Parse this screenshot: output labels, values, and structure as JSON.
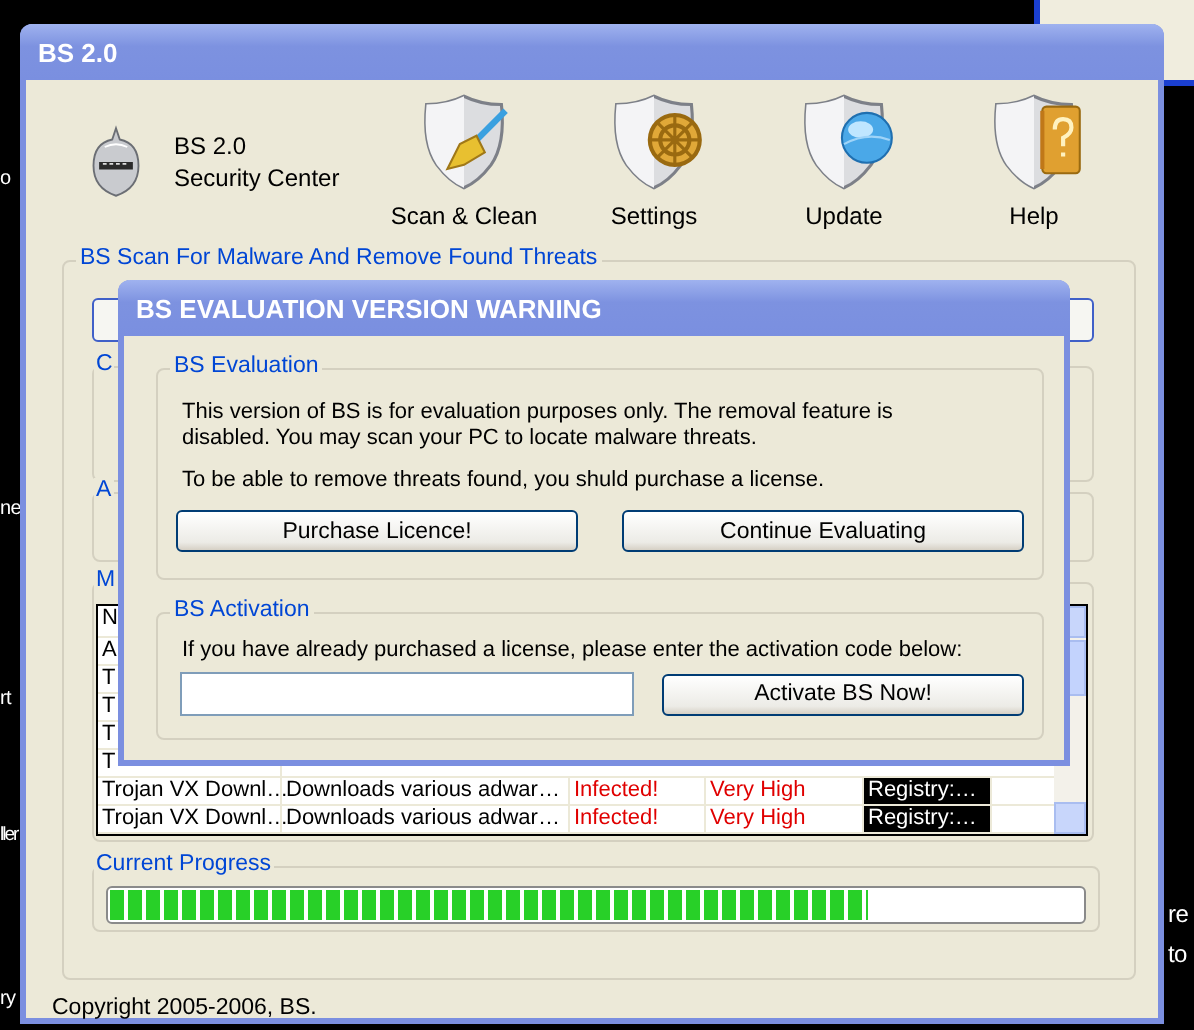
{
  "desktop": {
    "left_labels": [
      {
        "text": "o",
        "kind": "upper"
      },
      {
        "text": "ne",
        "kind": "mid"
      },
      {
        "text": "rt",
        "kind": "low"
      },
      {
        "text": "ller",
        "kind": "lower"
      },
      {
        "text": "ry",
        "kind": "bottom"
      }
    ],
    "right_labels": [
      "re",
      "to"
    ]
  },
  "window": {
    "title": "BS 2.0"
  },
  "brand": {
    "name": "BS 2.0",
    "subtitle": "Security Center"
  },
  "toolbar": [
    {
      "label": "Scan & Clean",
      "kind": "broom"
    },
    {
      "label": "Settings",
      "kind": "wheel"
    },
    {
      "label": "Update",
      "kind": "globe"
    },
    {
      "label": "Help",
      "kind": "book"
    }
  ],
  "scan_group": {
    "title": "BS Scan For Malware And Remove Found Threats",
    "group_labels": [
      "C",
      "A",
      "M"
    ],
    "table": {
      "columns": [
        "N"
      ],
      "rows": [
        {
          "cells": [
            "A"
          ]
        },
        {
          "cells": [
            "T"
          ]
        },
        {
          "cells": [
            "T"
          ]
        },
        {
          "cells": [
            "T"
          ]
        },
        {
          "cells": [
            "T"
          ]
        },
        {
          "cells": [
            "Trojan VX Downl…",
            "Downloads various adwar…",
            "Infected!",
            "Very High",
            "Registry:…"
          ]
        },
        {
          "cells": [
            "Trojan VX Downl…",
            "Downloads various adwar…",
            "Infected!",
            "Very High",
            "Registry:…"
          ]
        }
      ]
    }
  },
  "progress": {
    "label": "Current Progress",
    "level": 0.78
  },
  "copyright": "Copyright 2005-2006, BS.",
  "dialog": {
    "title": "BS EVALUATION VERSION WARNING",
    "evaluation": {
      "title": "BS Evaluation",
      "paragraphs": [
        "This version of BS is for evaluation purposes only. The removal feature is disabled. You may scan your PC to locate malware threats.",
        "To be able to remove threats found, you shuld purchase a license."
      ],
      "buttons": [
        "Purchase Licence!",
        "Continue Evaluating"
      ]
    },
    "activation": {
      "title": "BS Activation",
      "prompt": "If you have already purchased a license, please enter the activation code below:",
      "button": "Activate BS Now!"
    }
  }
}
